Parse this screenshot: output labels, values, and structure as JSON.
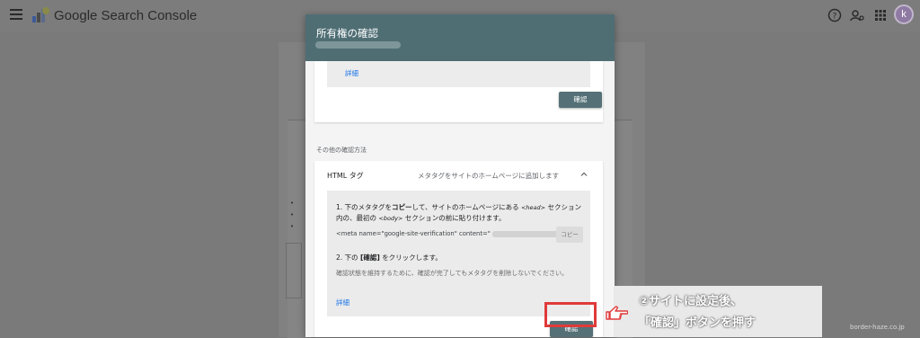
{
  "app": {
    "title": "Google Search Console"
  },
  "topbar": {
    "menu_icon": "menu-icon",
    "help_icon": "help-icon",
    "account_settings_icon": "manage-accounts-icon",
    "apps_icon": "apps-grid-icon",
    "avatar_letter": "k"
  },
  "background_page": {
    "bullets": [
      "•",
      "•",
      "•"
    ]
  },
  "dialog": {
    "title": "所有権の確認",
    "top_card": {
      "details_link": "詳細",
      "confirm_button": "確認"
    },
    "other_methods_label": "その他の確認方法",
    "html_tag_card": {
      "name": "HTML タグ",
      "description": "メタタグをサイトのホームページに追加します",
      "step1_prefix": "1. 下のメタタグを",
      "step1_bold": "コピー",
      "step1_mid": "して、サイトのホームページにある",
      "step1_head_tag": "<head>",
      "step1_mid2": "セクション内の、最初の",
      "step1_body_tag": "<body>",
      "step1_suffix": "セクションの前に貼り付けます。",
      "meta_text": "<meta name=\"google-site-verification\" content=\"",
      "meta_end": "\">",
      "copy_button": "コピー",
      "step2_prefix": "2. 下の",
      "step2_bold": "[確認]",
      "step2_suffix": "をクリックします。",
      "note": "確認状態を維持するために、確認が完了してもメタタグを削除しないでください。",
      "details_link": "詳細",
      "confirm_button": "確認"
    }
  },
  "annotation": {
    "line1": "②サイトに設定後、",
    "line2": "「確認」ボタンを押す",
    "hand_icon": "pointing-hand-icon"
  },
  "watermark": "border-haze.co.jp",
  "colors": {
    "header": "#4f6e74",
    "button": "#557177",
    "link": "#1a73e8",
    "highlight": "#e03a3a"
  }
}
